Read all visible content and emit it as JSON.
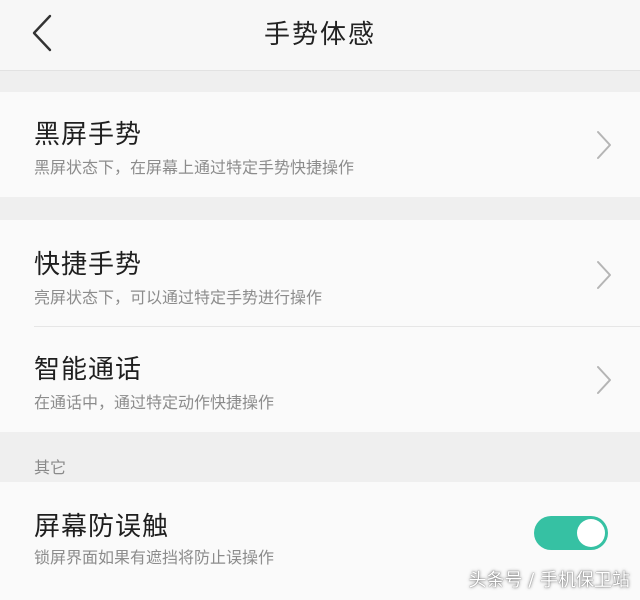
{
  "header": {
    "title": "手势体感",
    "back_icon": "back-arrow-icon"
  },
  "settings": {
    "black_screen": {
      "title": "黑屏手势",
      "subtitle": "黑屏状态下，在屏幕上通过特定手势快捷操作"
    },
    "quick_gesture": {
      "title": "快捷手势",
      "subtitle": "亮屏状态下，可以通过特定手势进行操作"
    },
    "smart_call": {
      "title": "智能通话",
      "subtitle": "在通话中，通过特定动作快捷操作"
    }
  },
  "other": {
    "section_label": "其它",
    "anti_mistouch": {
      "title": "屏幕防误触",
      "subtitle": "锁屏界面如果有遮挡将防止误操作",
      "enabled": true
    }
  },
  "watermark": "头条号 / 手机保卫站",
  "colors": {
    "toggle_on": "#36c1a3",
    "card_bg": "#fafafa",
    "page_bg": "#efefef"
  }
}
